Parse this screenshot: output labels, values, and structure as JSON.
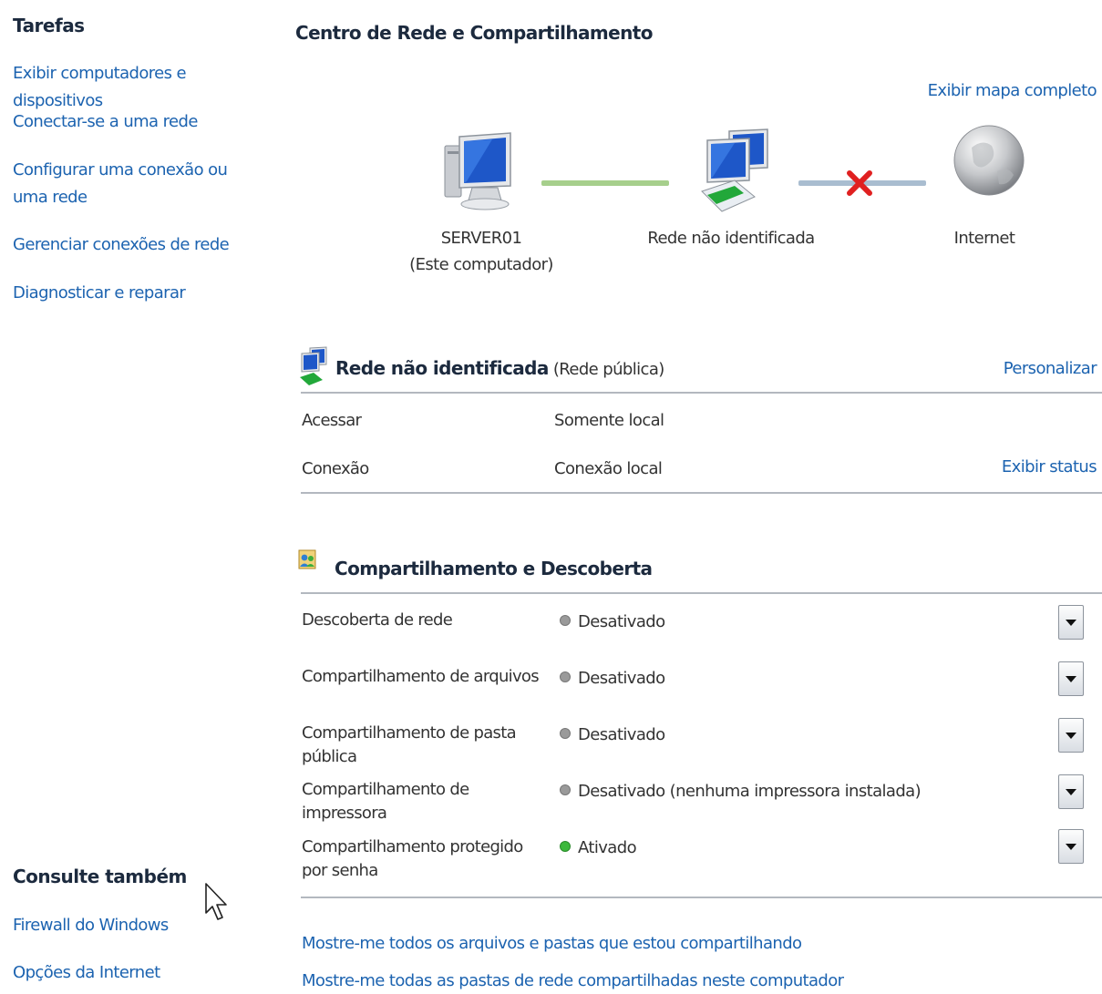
{
  "sidebar": {
    "tasks_title": "Tarefas",
    "tasks": [
      {
        "label": "Exibir computadores e dispositivos"
      },
      {
        "label": "Conectar-se a uma rede"
      },
      {
        "label": "Configurar uma conexão ou uma rede"
      },
      {
        "label": "Gerenciar conexões de rede"
      },
      {
        "label": "Diagnosticar e reparar"
      }
    ],
    "see_also_title": "Consulte também",
    "see_also": [
      {
        "label": "Firewall do Windows"
      },
      {
        "label": "Opções da Internet"
      }
    ]
  },
  "main": {
    "title": "Centro de Rede e Compartilhamento",
    "full_map_link": "Exibir mapa completo",
    "map": {
      "computer": {
        "name": "SERVER01",
        "sub": "(Este computador)",
        "icon": "computer-icon"
      },
      "network": {
        "name": "Rede não identificada",
        "icon": "network-icon"
      },
      "internet": {
        "name": "Internet",
        "icon": "globe-icon"
      },
      "link1_status": "connected",
      "link2_status": "disconnected"
    },
    "network_section": {
      "name": "Rede não identificada",
      "type": "(Rede pública)",
      "customize_link": "Personalizar",
      "rows": [
        {
          "label": "Acessar",
          "value": "Somente local"
        },
        {
          "label": "Conexão",
          "value": "Conexão local",
          "action": "Exibir status"
        }
      ]
    },
    "sharing_section": {
      "title": "Compartilhamento e Descoberta",
      "rows": [
        {
          "label": "Descoberta de rede",
          "status": "Desativado"
        },
        {
          "label": "Compartilhamento de arquivos",
          "status": "Desativado"
        },
        {
          "label": "Compartilhamento de pasta pública",
          "status": "Desativado"
        },
        {
          "label": "Compartilhamento de impressora",
          "status": "Desativado (nenhuma impressora instalada)"
        },
        {
          "label": "Compartilhamento protegido por senha",
          "status": "Ativado"
        }
      ]
    },
    "bottom_links": [
      {
        "label": "Mostre-me todos os arquivos e pastas que estou compartilhando"
      },
      {
        "label": "Mostre-me todas as pastas de rede compartilhadas neste computador"
      }
    ]
  },
  "colors": {
    "link": "#1c63b0",
    "heading": "#1c2a3e",
    "status_off": "#9a9a9a",
    "status_on": "#3cb83c",
    "connection_ok": "#a6cf8c",
    "connection_broken": "#a9bdd0",
    "broken_x": "#e02020"
  }
}
